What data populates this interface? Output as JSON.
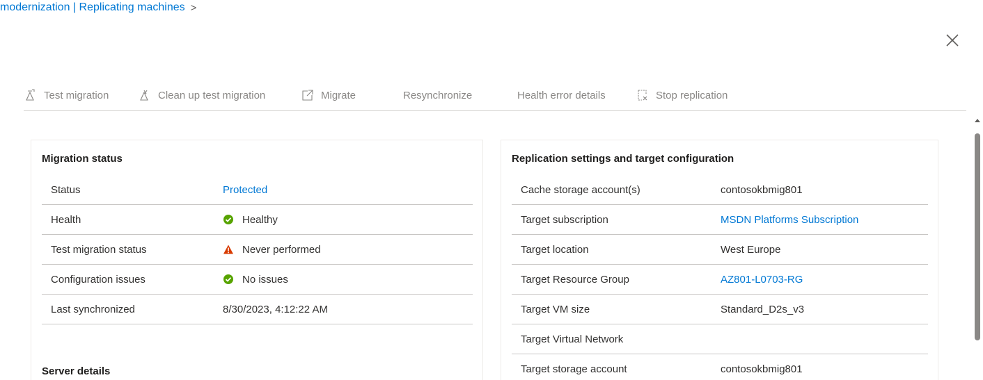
{
  "breadcrumb": {
    "text": "modernization | Replicating machines",
    "separator": ">"
  },
  "toolbar": {
    "items": [
      {
        "label": "Test migration",
        "icon": "test-migration-icon"
      },
      {
        "label": "Clean up test migration",
        "icon": "clean-up-icon"
      },
      {
        "label": "Migrate",
        "icon": "migrate-icon"
      },
      {
        "label": "Resynchronize",
        "icon": ""
      },
      {
        "label": "Health error details",
        "icon": ""
      },
      {
        "label": "Stop replication",
        "icon": "stop-replication-icon"
      }
    ]
  },
  "migration_status": {
    "title": "Migration status",
    "rows": [
      {
        "key": "Status",
        "value": "Protected",
        "icon": ""
      },
      {
        "key": "Health",
        "value": "Healthy",
        "icon": "success-check-icon"
      },
      {
        "key": "Test migration status",
        "value": "Never performed",
        "icon": "warning-icon"
      },
      {
        "key": "Configuration issues",
        "value": "No issues",
        "icon": "success-check-icon"
      },
      {
        "key": "Last synchronized",
        "value": "8/30/2023, 4:12:22 AM",
        "icon": ""
      }
    ]
  },
  "server_details": {
    "title": "Server details"
  },
  "replication_settings": {
    "title": "Replication settings and target configuration",
    "rows": [
      {
        "key": "Cache storage account(s)",
        "value": "contosokbmig801"
      },
      {
        "key": "Target subscription",
        "value": "MSDN Platforms Subscription"
      },
      {
        "key": "Target location",
        "value": "West Europe"
      },
      {
        "key": "Target Resource Group",
        "value": "AZ801-L0703-RG"
      },
      {
        "key": "Target VM size",
        "value": "Standard_D2s_v3"
      },
      {
        "key": "Target Virtual Network",
        "value": ""
      },
      {
        "key": "Target storage account",
        "value": "contosokbmig801"
      }
    ]
  },
  "colors": {
    "link": "#0078d4",
    "success": "#57a300",
    "warning": "#d83b01",
    "disabled_text": "#8a8886"
  }
}
